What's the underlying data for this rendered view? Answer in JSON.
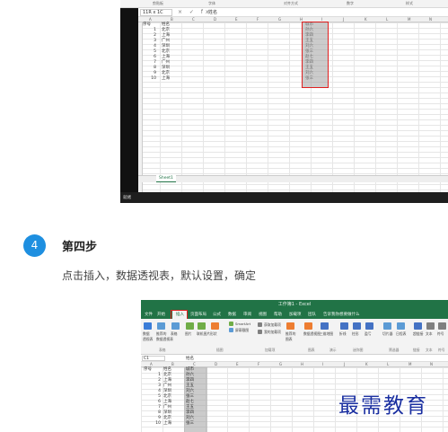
{
  "shot1": {
    "ribbon_groups": [
      "剪贴板",
      "字体",
      "对齐方式",
      "数字",
      "样式"
    ],
    "name_box": "11R x 1C",
    "formula_icons": "× ✓ fx",
    "formula_value": "姓名",
    "columns": [
      "A",
      "B",
      "C",
      "D",
      "E",
      "F",
      "G",
      "H",
      "I",
      "J",
      "K",
      "L",
      "M",
      "N",
      "O"
    ],
    "header_row": [
      "序号",
      "姓名",
      "城市"
    ],
    "rows": [
      [
        "1",
        "北京",
        "孙六"
      ],
      [
        "2",
        "上海",
        "李四"
      ],
      [
        "3",
        "广州",
        "王五"
      ],
      [
        "4",
        "深圳",
        "刘六"
      ],
      [
        "5",
        "北京",
        "张三"
      ],
      [
        "6",
        "上海",
        "赵七"
      ],
      [
        "7",
        "广州",
        "李四"
      ],
      [
        "8",
        "深圳",
        "王五"
      ],
      [
        "9",
        "北京",
        "刘六"
      ],
      [
        "10",
        "上海",
        "张三"
      ]
    ],
    "sheet_tab": "Sheet1",
    "status": "就绪"
  },
  "step": {
    "number": "4",
    "title": "第四步",
    "description": "点击插入，数据透视表，默认设置，确定"
  },
  "shot2": {
    "window_title": "工作簿1 - Excel",
    "menu": [
      "文件",
      "开始",
      "插入",
      "页面布局",
      "公式",
      "数据",
      "审阅",
      "视图",
      "帮助",
      "加载项",
      "团队",
      "告诉我你想要做什么"
    ],
    "active_menu": "插入",
    "ribbon_buttons": [
      {
        "label": "数据\n透视表",
        "icon": "pivot-table-icon",
        "color": "#3b7dd8"
      },
      {
        "label": "推荐的\n数据透视表",
        "icon": "recommended-pivot-icon",
        "color": "#5b9bd5"
      },
      {
        "label": "表格",
        "icon": "table-icon",
        "color": "#5b9bd5"
      },
      {
        "label": "图片",
        "icon": "picture-icon",
        "color": "#70ad47"
      },
      {
        "label": "联机图片",
        "icon": "online-picture-icon",
        "color": "#70ad47"
      },
      {
        "label": "形状",
        "icon": "shapes-icon",
        "color": "#ed7d31"
      },
      {
        "label": "SmartArt",
        "icon": "smartart-icon",
        "color": "#70ad47"
      },
      {
        "label": "屏幕截图",
        "icon": "screenshot-icon",
        "color": "#5b9bd5"
      },
      {
        "label": "获取加载项",
        "icon": "store-icon",
        "color": "#7f7f7f"
      },
      {
        "label": "我的加载项",
        "icon": "addins-icon",
        "color": "#7f7f7f"
      },
      {
        "label": "推荐的\n图表",
        "icon": "recommended-chart-icon",
        "color": "#ed7d31"
      },
      {
        "label": "数据透视图",
        "icon": "pivot-chart-icon",
        "color": "#ed7d31"
      },
      {
        "label": "三维地图",
        "icon": "3d-map-icon",
        "color": "#4472c4"
      },
      {
        "label": "折线",
        "icon": "sparkline-line-icon",
        "color": "#4472c4"
      },
      {
        "label": "柱形",
        "icon": "sparkline-column-icon",
        "color": "#4472c4"
      },
      {
        "label": "盈亏",
        "icon": "win-loss-icon",
        "color": "#4472c4"
      },
      {
        "label": "切片器",
        "icon": "slicer-icon",
        "color": "#5b9bd5"
      },
      {
        "label": "日程表",
        "icon": "timeline-icon",
        "color": "#5b9bd5"
      },
      {
        "label": "超链接",
        "icon": "hyperlink-icon",
        "color": "#4472c4"
      },
      {
        "label": "文本",
        "icon": "text-icon",
        "color": "#7f7f7f"
      },
      {
        "label": "符号",
        "icon": "symbol-icon",
        "color": "#7f7f7f"
      }
    ],
    "ribbon_groups": [
      "表格",
      "插图",
      "加载项",
      "图表",
      "演示",
      "迷你图",
      "筛选器",
      "链接",
      "文本",
      "符号"
    ],
    "name_box": "C1",
    "formula_value": "姓名",
    "columns": [
      "A",
      "B",
      "C",
      "D",
      "E",
      "F",
      "G",
      "H",
      "I",
      "J",
      "K",
      "L",
      "M",
      "N"
    ],
    "header_row": [
      "序号",
      "姓名",
      "城市"
    ],
    "rows": [
      [
        "1",
        "北京",
        "孙六"
      ],
      [
        "2",
        "上海",
        "李四"
      ],
      [
        "3",
        "广州",
        "王五"
      ],
      [
        "4",
        "深圳",
        "刘六"
      ],
      [
        "5",
        "北京",
        "张三"
      ],
      [
        "6",
        "上海",
        "赵七"
      ],
      [
        "7",
        "广州",
        "王五"
      ],
      [
        "8",
        "深圳",
        "李四"
      ],
      [
        "9",
        "北京",
        "刘六"
      ],
      [
        "10",
        "上海",
        "张三"
      ]
    ]
  },
  "watermark": "最需教育",
  "colors": {
    "excel_green": "#217346",
    "badge_blue": "#1e8fe0",
    "highlight_red": "#e02020",
    "watermark_blue": "#1a2fa0"
  }
}
